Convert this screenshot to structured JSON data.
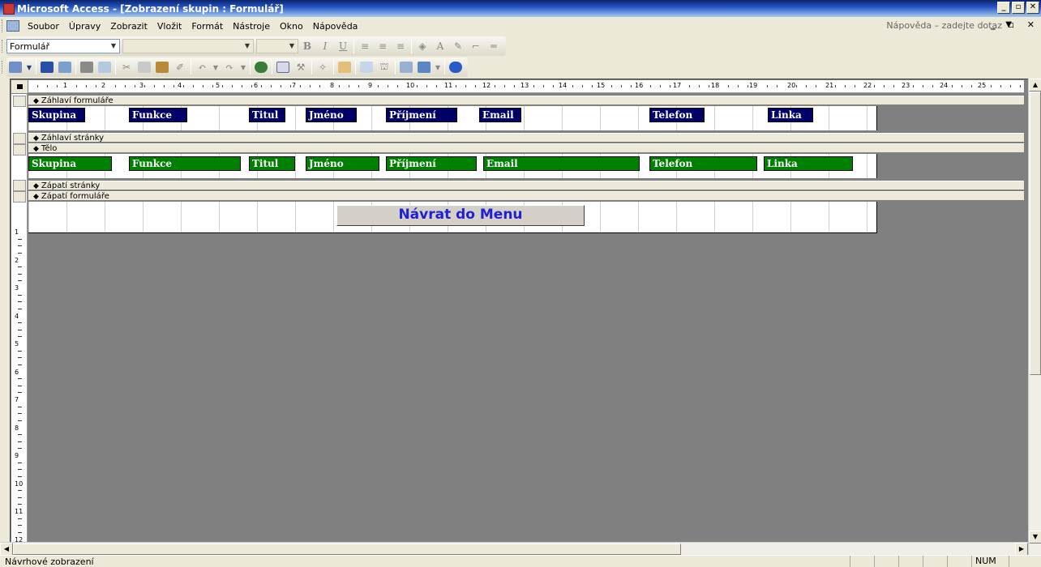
{
  "window": {
    "title": "Microsoft Access - [Zobrazení skupin : Formulář]",
    "controls": [
      "_",
      "▫",
      "✕"
    ]
  },
  "menubar": {
    "items": [
      "Soubor",
      "Úpravy",
      "Zobrazit",
      "Vložit",
      "Formát",
      "Nástroje",
      "Okno",
      "Nápověda"
    ],
    "help_placeholder": "Nápověda – zadejte dotaz",
    "mdi_controls": "_ ▫ ✕"
  },
  "formatting_toolbar": {
    "object_combo": "Formulář",
    "font_combo": "",
    "size_combo": "",
    "bold": "B",
    "italic": "I",
    "underline": "U",
    "font_color": "A"
  },
  "design": {
    "ruler_numbers": [
      "1",
      "2",
      "3",
      "4",
      "5",
      "6",
      "7",
      "8",
      "9",
      "10",
      "11",
      "12",
      "13",
      "14",
      "15",
      "16",
      "17",
      "18",
      "19",
      "20",
      "21",
      "22",
      "23",
      "24",
      "25"
    ],
    "vruler_numbers": [
      "1",
      "2",
      "3",
      "4",
      "5",
      "6",
      "7",
      "8",
      "9",
      "10",
      "11",
      "12"
    ],
    "sections": {
      "form_header": "Záhlaví formuláře",
      "page_header": "Záhlaví stránky",
      "detail": "Tělo",
      "page_footer": "Zápatí stránky",
      "form_footer": "Zápatí formuláře"
    },
    "header_labels": [
      "Skupina",
      "Funkce",
      "Titul",
      "Jméno",
      "Příjmení",
      "Email",
      "Telefon",
      "Linka"
    ],
    "detail_fields": [
      "Skupina",
      "Funkce",
      "Titul",
      "Jméno",
      "Příjmení",
      "Email",
      "Telefon",
      "Linka"
    ],
    "footer_button": "Návrat do Menu"
  },
  "statusbar": {
    "text": "Návrhové zobrazení",
    "num": "NUM"
  },
  "colors": {
    "label_navy": "#000066",
    "field_green": "#008000",
    "button_text": "#1f1fd8"
  }
}
